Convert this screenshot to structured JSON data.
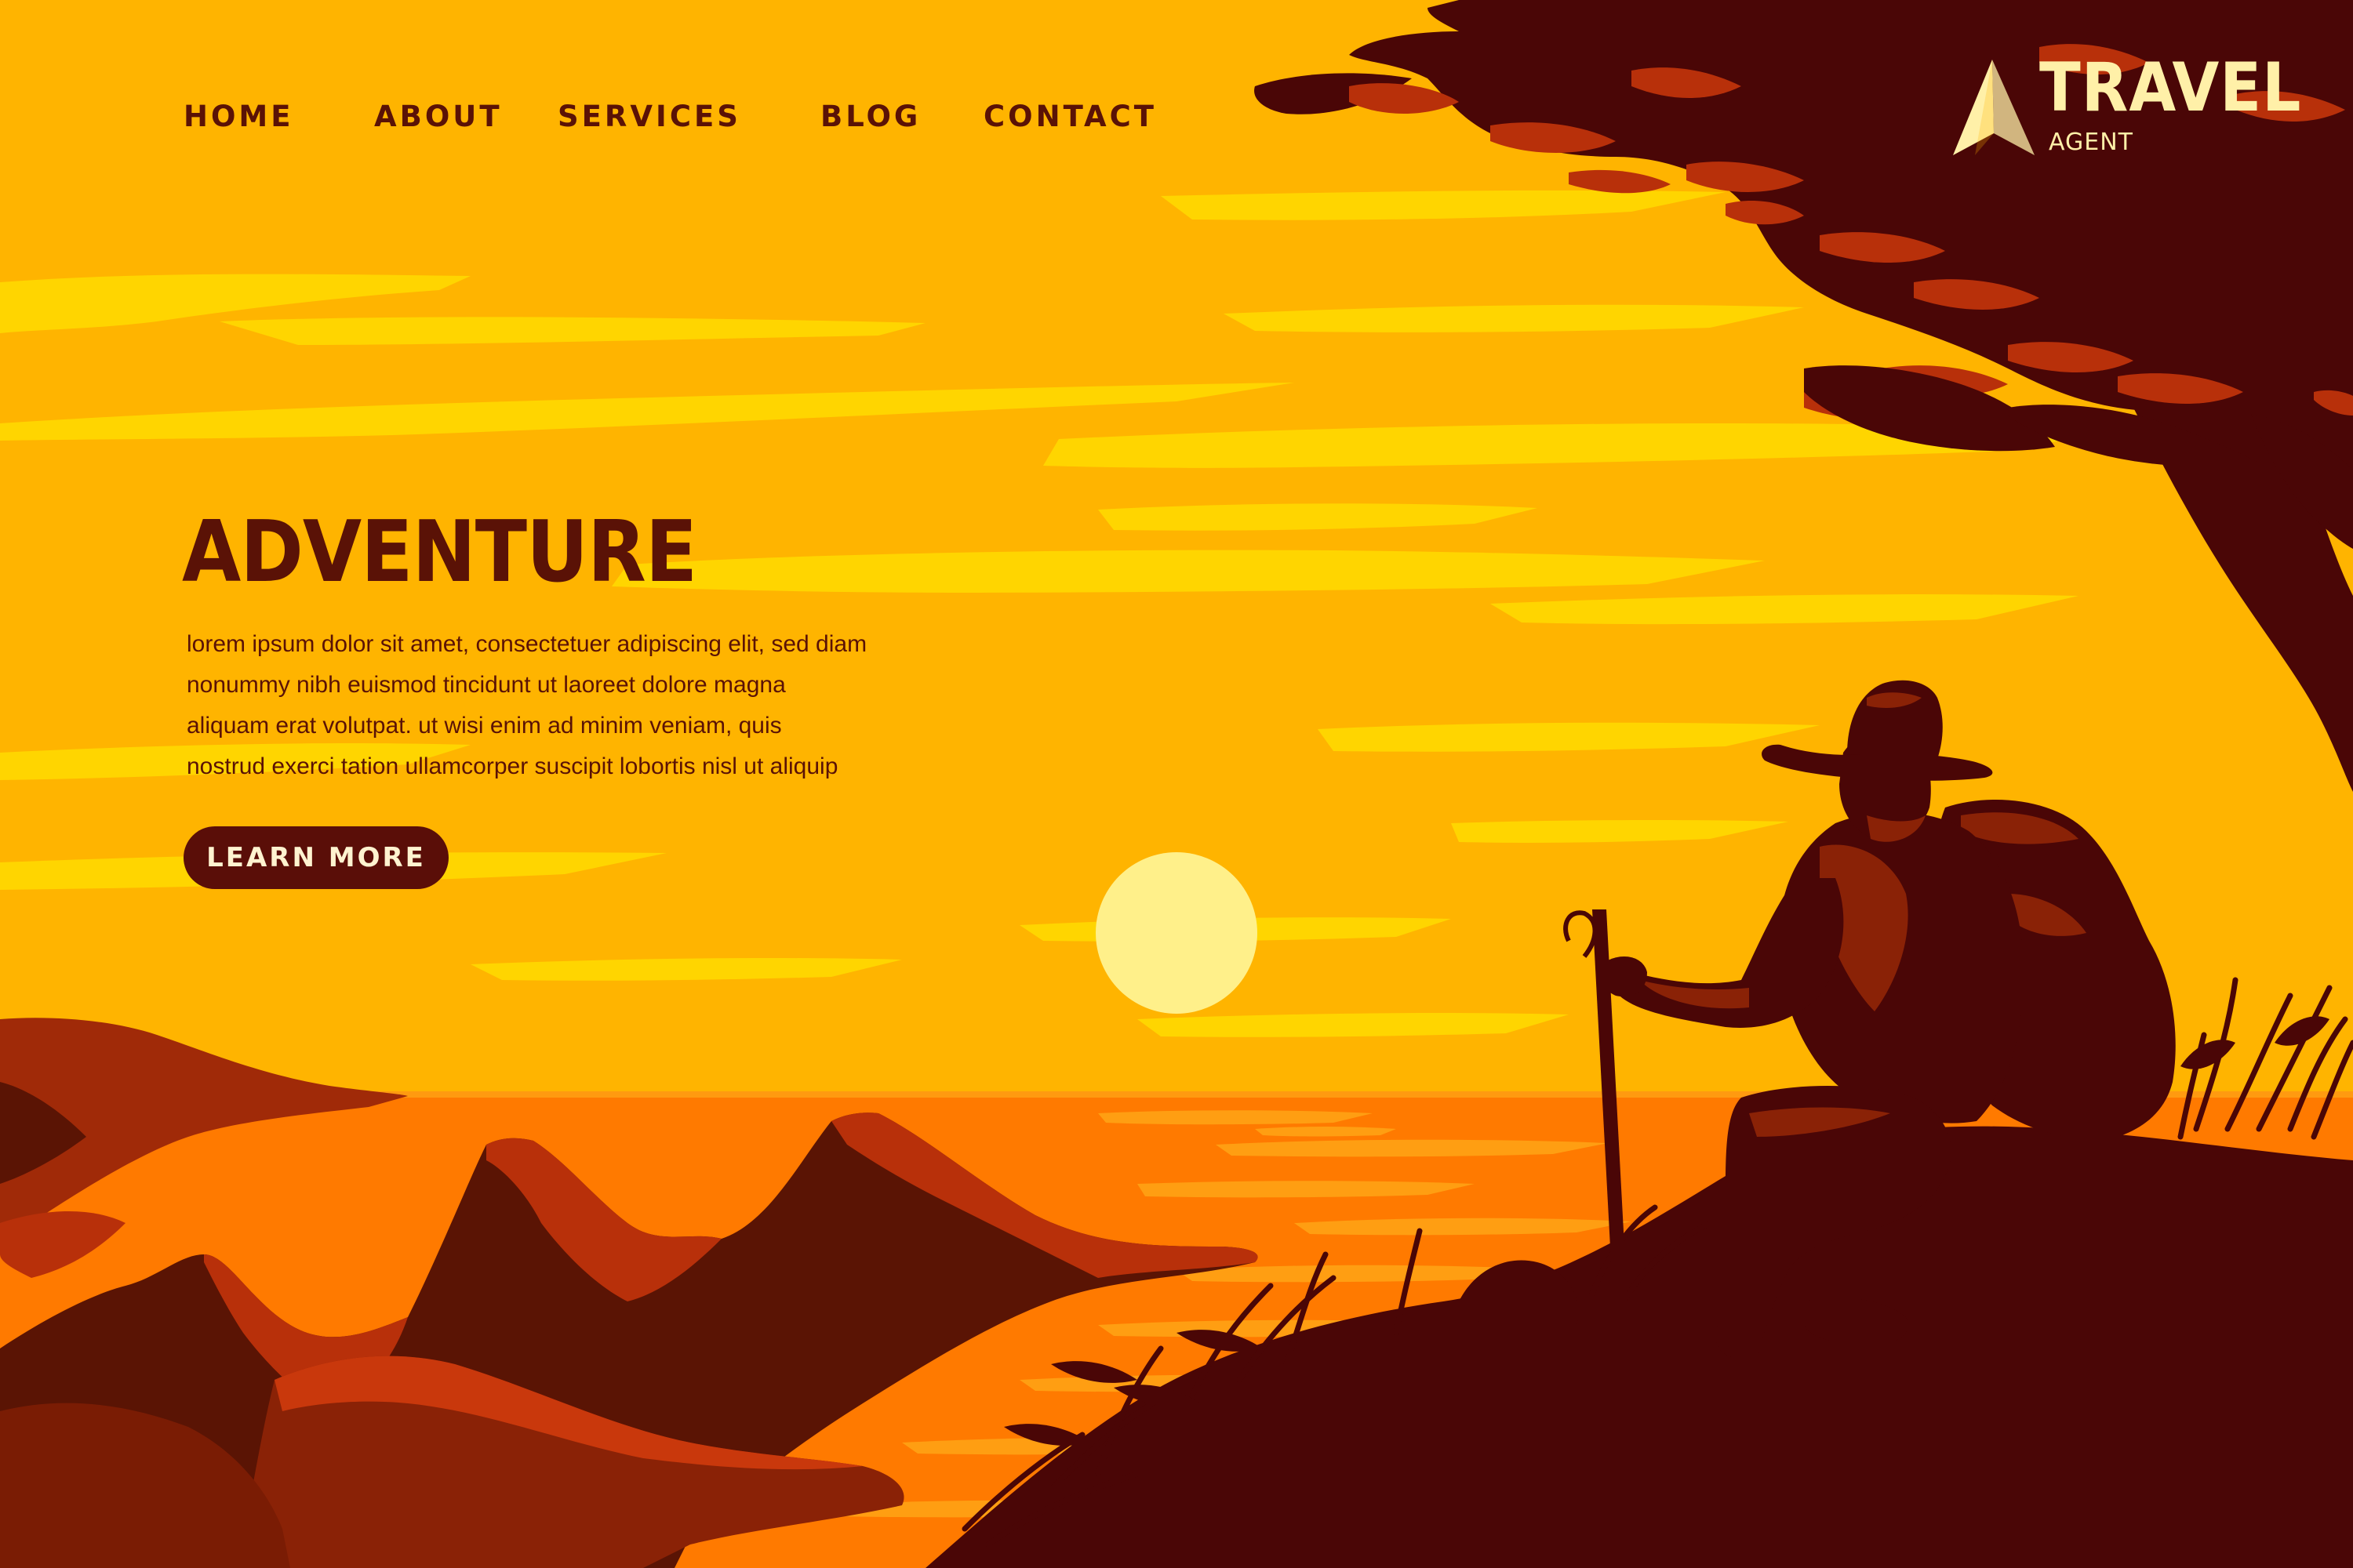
{
  "nav": {
    "items": [
      {
        "label": "HOME"
      },
      {
        "label": "ABOUT"
      },
      {
        "label": "SERVICES"
      },
      {
        "label": "BLOG"
      },
      {
        "label": "CONTACT"
      }
    ]
  },
  "logo": {
    "title": "TRAVEL",
    "subtitle": "AGENT"
  },
  "hero": {
    "title": "ADVENTURE",
    "body_lines": [
      "lorem ipsum dolor sit amet, consectetuer adipiscing elit, sed diam",
      "nonummy nibh euismod tincidunt ut laoreet dolore magna",
      "aliquam erat volutpat. ut wisi enim ad minim veniam, quis",
      "nostrud exerci tation ullamcorper suscipit lobortis nisl ut aliquip"
    ],
    "cta_label": "LEARN MORE"
  },
  "colors": {
    "sky": "#ffb800",
    "sky_light": "#ffd400",
    "dark_brown": "#4a0606",
    "text_brown": "#5a1206",
    "mountain_red": "#b8300a",
    "mountain_dark": "#5a1404",
    "sea_orange": "#ff7a00",
    "sun": "#fff08a",
    "cta_bg": "#5a0e08",
    "logo_cream": "#fff0a8"
  }
}
